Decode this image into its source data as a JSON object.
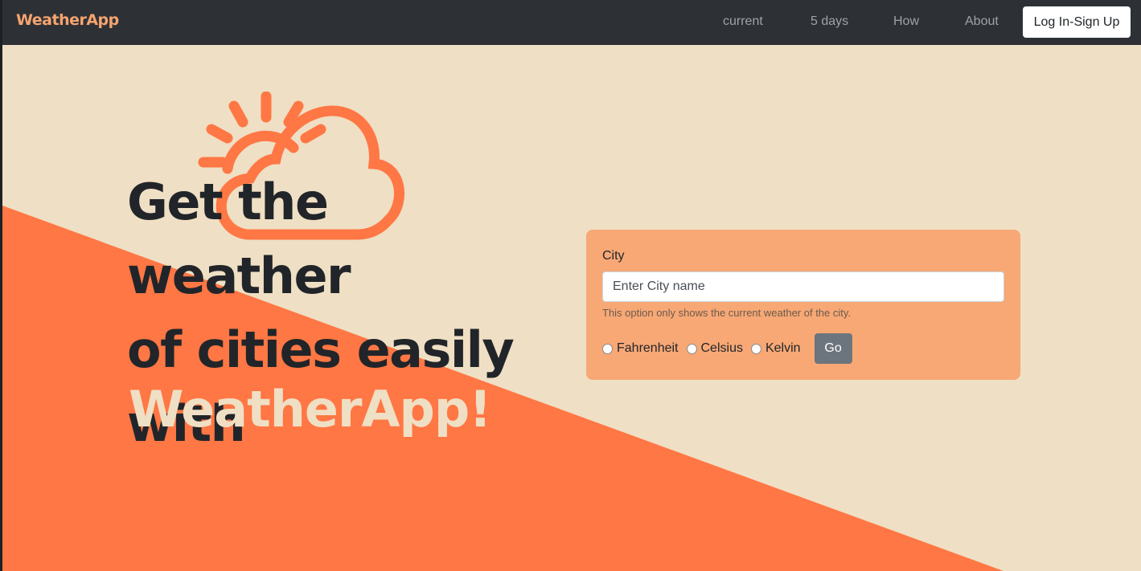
{
  "navbar": {
    "brand": "WeatherApp",
    "links": [
      "current",
      "5 days",
      "How",
      "About"
    ],
    "login_label": "Log In-Sign Up"
  },
  "hero": {
    "headline_line1": "Get the weather",
    "headline_line2": "of cities easily",
    "headline_line3": "with",
    "headline_brand": "WeatherApp!",
    "icon": "sun-cloud-icon"
  },
  "form": {
    "city_label": "City",
    "city_placeholder": "Enter City name",
    "help_text": "This option only shows the current weather of the city.",
    "units": [
      "Fahrenheit",
      "Celsius",
      "Kelvin"
    ],
    "go_label": "Go"
  },
  "colors": {
    "navbar_bg": "#2d3136",
    "brand_accent": "#f6a46f",
    "background_cream": "#efdfc4",
    "diagonal_orange": "#ff7744",
    "card_bg": "#f7a875",
    "go_button": "#6c757d"
  }
}
